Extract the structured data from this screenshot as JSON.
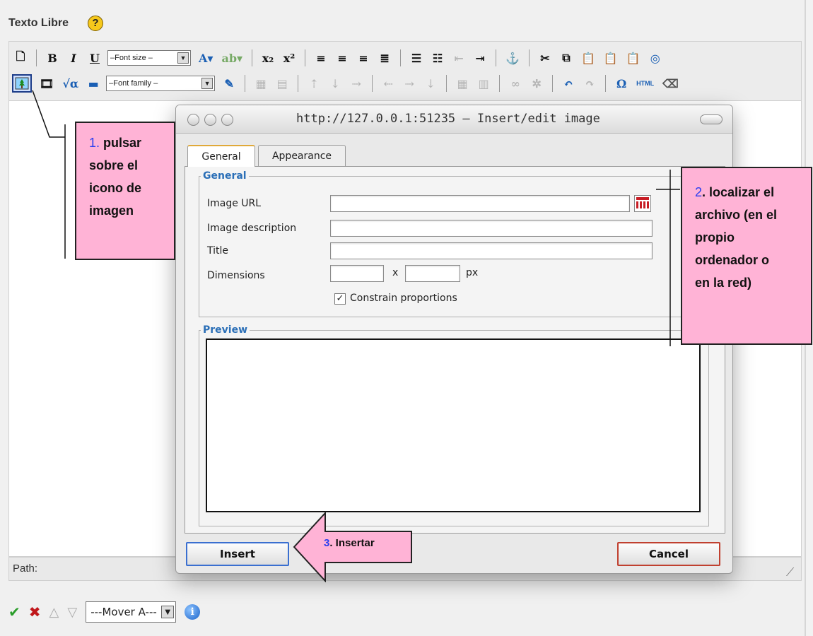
{
  "editor": {
    "section_title": "Texto Libre",
    "help_icon": "?",
    "toolbar": {
      "font_size_select": "–Font size –",
      "font_family_select": "–Font family –",
      "special_char": "Ω",
      "html_label": "HTML"
    },
    "path_label": "Path:"
  },
  "bottom_bar": {
    "move_select": "---Mover A---"
  },
  "dialog": {
    "title": "http://127.0.0.1:51235 – Insert/edit image",
    "tabs": [
      "General",
      "Appearance"
    ],
    "general_legend": "General",
    "fields": {
      "image_url": {
        "label": "Image URL",
        "value": ""
      },
      "image_description": {
        "label": "Image description",
        "value": ""
      },
      "title": {
        "label": "Title",
        "value": ""
      },
      "dimensions": {
        "label": "Dimensions",
        "width": "",
        "height": "",
        "separator": "x",
        "unit": "px"
      }
    },
    "constrain_label": "Constrain proportions",
    "constrain_checked": "✓",
    "preview_legend": "Preview",
    "insert_label": "Insert",
    "cancel_label": "Cancel"
  },
  "annotations": {
    "step1": {
      "number": "1.",
      "text_lines": [
        "pulsar",
        "sobre el",
        "icono de",
        "imagen"
      ]
    },
    "step2": {
      "number": "2",
      "text_lines": [
        ". localizar el",
        "archivo (en el",
        "propio",
        "ordenador o",
        "en la red)"
      ]
    },
    "step3": {
      "number": "3",
      "text": ". Insertar"
    },
    "colors": {
      "callout_fill": "#ffb3d6",
      "number_color": "#2a3ef0"
    }
  }
}
